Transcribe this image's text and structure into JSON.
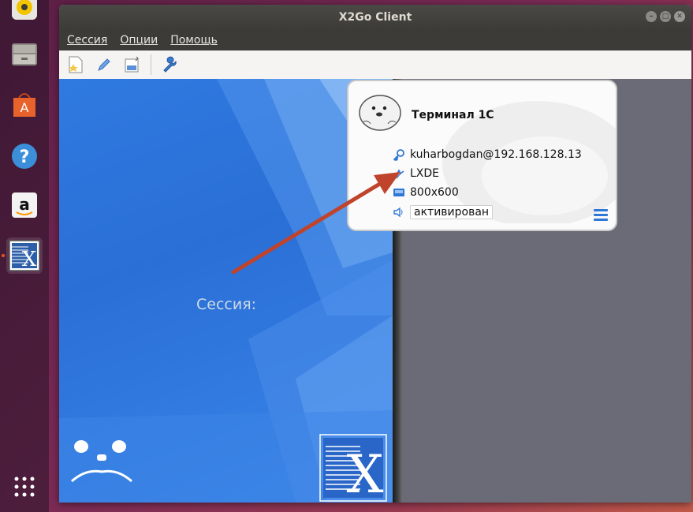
{
  "window": {
    "title": "X2Go Client"
  },
  "menubar": {
    "items": [
      "Сессия",
      "Опции",
      "Помощь"
    ]
  },
  "toolbar": {
    "buttons": [
      "new-session-icon",
      "edit-session-icon",
      "session-settings-icon",
      "preferences-wrench-icon"
    ]
  },
  "left_panel": {
    "session_label": "Сессия:"
  },
  "session_card": {
    "name": "Терминал 1С",
    "server": "kuharbogdan@192.168.128.13",
    "desktop": "LXDE",
    "resolution": "800x600",
    "sound": "активирован"
  },
  "dock": {
    "items": [
      "rhythmbox-icon",
      "files-icon",
      "software-center-icon",
      "help-icon",
      "amazon-icon",
      "x2go-icon",
      "apps-grid-icon"
    ]
  },
  "colors": {
    "ubuntu_accent": "#e95420",
    "x2go_blue": "#2f7ae0",
    "arrow": "#c0432c"
  }
}
